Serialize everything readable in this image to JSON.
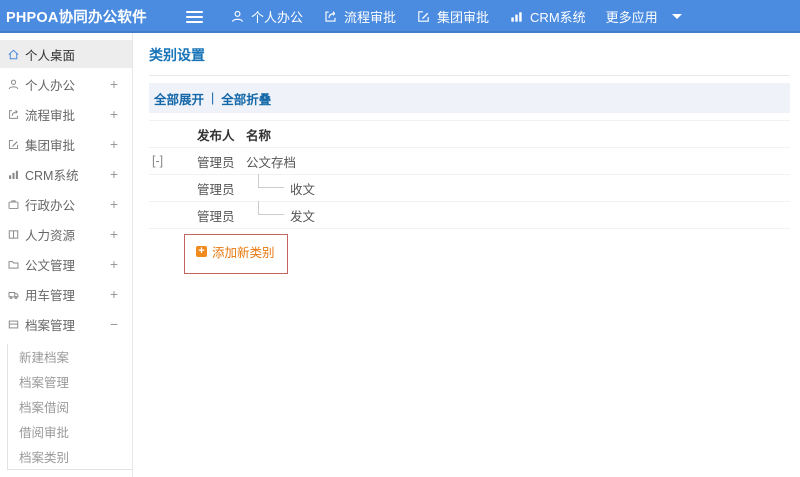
{
  "header": {
    "logo": "PHPOA协同办公软件",
    "nav": [
      {
        "label": "个人办公",
        "icon": "user-icon"
      },
      {
        "label": "流程审批",
        "icon": "flow-icon"
      },
      {
        "label": "集团审批",
        "icon": "edit-icon"
      },
      {
        "label": "CRM系统",
        "icon": "bar-chart-icon"
      },
      {
        "label": "更多应用",
        "icon": "caret-down-icon"
      }
    ]
  },
  "sidebar": {
    "items": [
      {
        "label": "个人桌面",
        "icon": "home-icon",
        "toggle": "",
        "active": true
      },
      {
        "label": "个人办公",
        "icon": "user-icon",
        "toggle": "+"
      },
      {
        "label": "流程审批",
        "icon": "flow-icon",
        "toggle": "+"
      },
      {
        "label": "集团审批",
        "icon": "edit-icon",
        "toggle": "+"
      },
      {
        "label": "CRM系统",
        "icon": "bar-chart-icon",
        "toggle": "+"
      },
      {
        "label": "行政办公",
        "icon": "briefcase-icon",
        "toggle": "+"
      },
      {
        "label": "人力资源",
        "icon": "book-icon",
        "toggle": "+"
      },
      {
        "label": "公文管理",
        "icon": "folder-icon",
        "toggle": "+"
      },
      {
        "label": "用车管理",
        "icon": "truck-icon",
        "toggle": "+"
      },
      {
        "label": "档案管理",
        "icon": "archive-icon",
        "toggle": "−",
        "expanded": true
      }
    ],
    "submenu": [
      {
        "label": "新建档案"
      },
      {
        "label": "档案管理"
      },
      {
        "label": "档案借阅"
      },
      {
        "label": "借阅审批"
      },
      {
        "label": "档案类别"
      }
    ]
  },
  "main": {
    "title": "类别设置",
    "toolbar": {
      "expand_all": "全部展开",
      "separator": "|",
      "collapse_all": "全部折叠"
    },
    "table": {
      "headers": {
        "publisher": "发布人",
        "name": "名称"
      },
      "rows": [
        {
          "toggle": "[-]",
          "publisher": "管理员",
          "name": "公文存档",
          "level": 0
        },
        {
          "toggle": "",
          "publisher": "管理员",
          "name": "收文",
          "level": 1
        },
        {
          "toggle": "",
          "publisher": "管理员",
          "name": "发文",
          "level": 1
        }
      ]
    },
    "add_button": {
      "plus": "+",
      "label": "添加新类别"
    }
  },
  "colors": {
    "header_bg": "#4b8ce0",
    "title_blue": "#1874b8",
    "toolbar_link_blue": "#1467a8",
    "accent_orange": "#f08a1c",
    "highlight_box_red": "#c4645f",
    "active_item_bg": "#ededed"
  }
}
